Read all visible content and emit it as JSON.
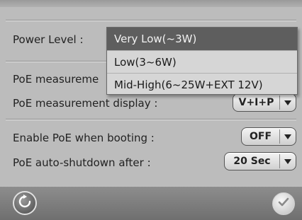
{
  "settings": {
    "power_level_label": "Power Level :",
    "poe_measurement_label": "PoE measureme",
    "poe_measurement_display_label": "PoE measurement display :",
    "poe_measurement_display_value": "V+I+P",
    "enable_poe_booting_label": "Enable PoE when booting :",
    "enable_poe_booting_value": "OFF",
    "poe_auto_shutdown_label": "PoE auto-shutdown after :",
    "poe_auto_shutdown_value": "20 Sec"
  },
  "power_level_dropdown": {
    "options": [
      {
        "label": "Very Low(~3W)",
        "selected": true
      },
      {
        "label": "Low(3~6W)",
        "selected": false
      },
      {
        "label": "Mid-High(6~25W+EXT 12V)",
        "selected": false
      }
    ]
  },
  "footer": {
    "reset_icon": "reset-icon",
    "confirm_icon": "checkmark-icon"
  },
  "colors": {
    "panel_bg": "#bcbcbc",
    "selected_option_bg": "#5e5e5e",
    "footer_bg": "#7f7f7f"
  }
}
